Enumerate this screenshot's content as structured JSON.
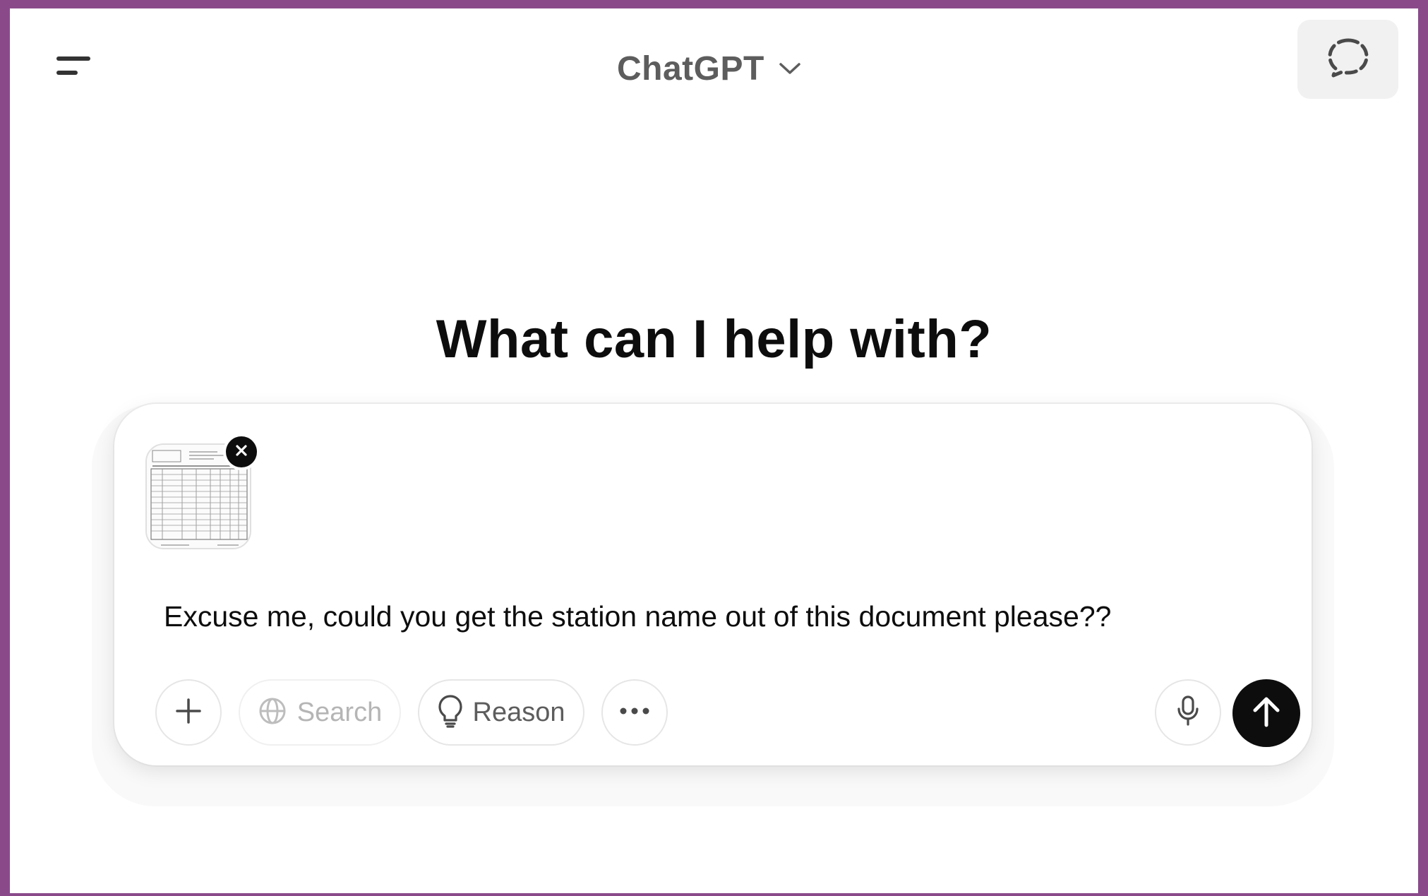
{
  "header": {
    "app_title": "ChatGPT",
    "menu_icon": "hamburger-menu-icon",
    "model_chevron_icon": "chevron-down-icon",
    "temp_chat_icon": "dashed-chat-bubble-icon"
  },
  "main": {
    "heading": "What can I help with?"
  },
  "composer": {
    "attachment": {
      "type": "document-image-thumbnail",
      "remove_icon": "close-icon"
    },
    "prompt_text": "Excuse me, could you get the station name out of this document please??",
    "tools": {
      "plus_icon": "plus-icon",
      "search_label": "Search",
      "search_icon": "globe-icon",
      "reason_label": "Reason",
      "reason_icon": "lightbulb-icon",
      "more_icon": "ellipsis-icon"
    },
    "mic_icon": "microphone-icon",
    "send_icon": "arrow-up-icon"
  },
  "colors": {
    "frame_border": "#8a4a8a",
    "send_button": "#0d0d0d",
    "muted_text": "#5d5d5d",
    "disabled_text": "#b5b5b5"
  }
}
